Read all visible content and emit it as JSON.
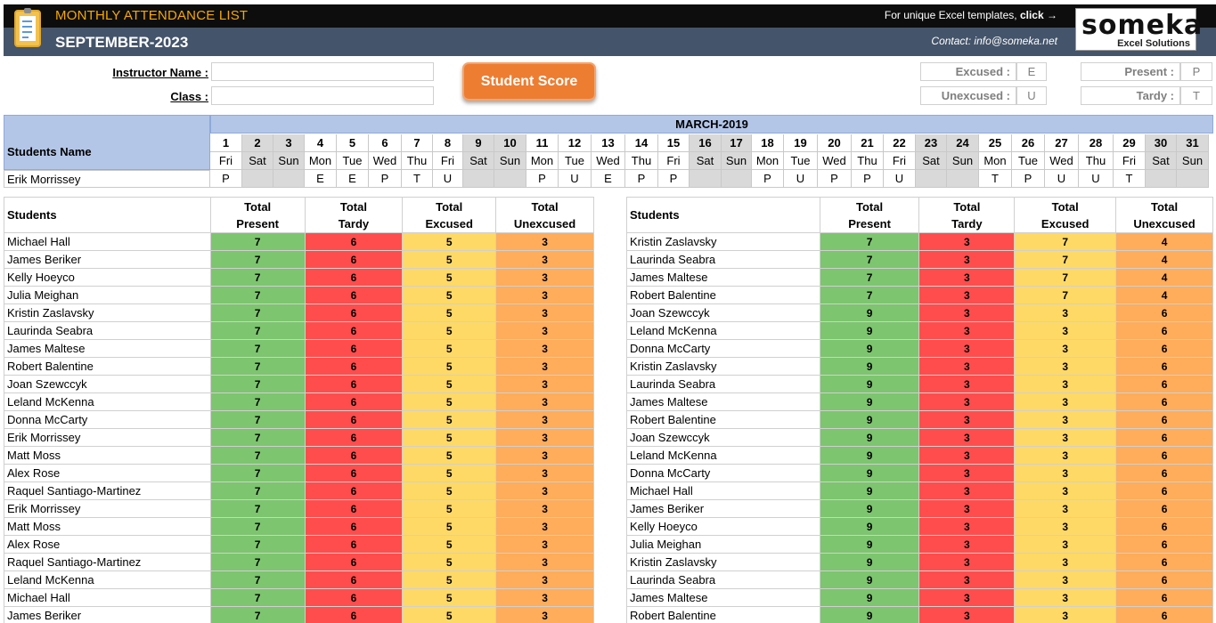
{
  "header": {
    "title": "MONTHLY ATTENDANCE LIST",
    "month": "SEPTEMBER-2023",
    "promo_text": "For unique Excel templates,",
    "promo_link": "click →",
    "contact": "Contact: info@someka.net",
    "brand": "someka",
    "brand_sub": "Excel Solutions"
  },
  "form": {
    "instructor_label": "Instructor Name :",
    "instructor_value": "",
    "class_label": "Class :",
    "class_value": ""
  },
  "score_button": "Student Score",
  "legend": {
    "excused_label": "Excused :",
    "excused_code": "E",
    "unexcused_label": "Unexcused :",
    "unexcused_code": "U",
    "present_label": "Present :",
    "present_code": "P",
    "tardy_label": "Tardy :",
    "tardy_code": "T"
  },
  "calendar": {
    "month_title": "MARCH-2019",
    "names_header": "Students Name",
    "days": [
      "1",
      "2",
      "3",
      "4",
      "5",
      "6",
      "7",
      "8",
      "9",
      "10",
      "11",
      "12",
      "13",
      "14",
      "15",
      "16",
      "17",
      "18",
      "19",
      "20",
      "21",
      "22",
      "23",
      "24",
      "25",
      "26",
      "27",
      "28",
      "29",
      "30",
      "31"
    ],
    "weekdays": [
      "Fri",
      "Sat",
      "Sun",
      "Mon",
      "Tue",
      "Wed",
      "Thu",
      "Fri",
      "Sat",
      "Sun",
      "Mon",
      "Tue",
      "Wed",
      "Thu",
      "Fri",
      "Sat",
      "Sun",
      "Mon",
      "Tue",
      "Wed",
      "Thu",
      "Fri",
      "Sat",
      "Sun",
      "Mon",
      "Tue",
      "Wed",
      "Thu",
      "Fri",
      "Sat",
      "Sun"
    ],
    "weekend": [
      false,
      true,
      true,
      false,
      false,
      false,
      false,
      false,
      true,
      true,
      false,
      false,
      false,
      false,
      false,
      true,
      true,
      false,
      false,
      false,
      false,
      false,
      true,
      true,
      false,
      false,
      false,
      false,
      false,
      true,
      true
    ],
    "student": "Erik Morrissey",
    "marks": [
      "P",
      "",
      "",
      "E",
      "E",
      "P",
      "T",
      "U",
      "",
      "",
      "P",
      "U",
      "E",
      "P",
      "P",
      "",
      "",
      "P",
      "U",
      "P",
      "P",
      "U",
      "",
      "",
      "T",
      "P",
      "U",
      "U",
      "T",
      "",
      ""
    ]
  },
  "summary": {
    "headers": {
      "students": "Students",
      "present": [
        "Total",
        "Present"
      ],
      "tardy": [
        "Total",
        "Tardy"
      ],
      "excused": [
        "Total",
        "Excused"
      ],
      "unexcused": [
        "Total",
        "Unexcused"
      ]
    },
    "left": [
      {
        "name": "Michael Hall",
        "present": "7",
        "tardy": "6",
        "excused": "5",
        "unexcused": "3"
      },
      {
        "name": "James Beriker",
        "present": "7",
        "tardy": "6",
        "excused": "5",
        "unexcused": "3"
      },
      {
        "name": "Kelly Hoeyco",
        "present": "7",
        "tardy": "6",
        "excused": "5",
        "unexcused": "3"
      },
      {
        "name": "Julia Meighan",
        "present": "7",
        "tardy": "6",
        "excused": "5",
        "unexcused": "3"
      },
      {
        "name": "Kristin Zaslavsky",
        "present": "7",
        "tardy": "6",
        "excused": "5",
        "unexcused": "3"
      },
      {
        "name": "Laurinda Seabra",
        "present": "7",
        "tardy": "6",
        "excused": "5",
        "unexcused": "3"
      },
      {
        "name": "James Maltese",
        "present": "7",
        "tardy": "6",
        "excused": "5",
        "unexcused": "3"
      },
      {
        "name": "Robert Balentine",
        "present": "7",
        "tardy": "6",
        "excused": "5",
        "unexcused": "3"
      },
      {
        "name": "Joan Szewccyk",
        "present": "7",
        "tardy": "6",
        "excused": "5",
        "unexcused": "3"
      },
      {
        "name": "Leland McKenna",
        "present": "7",
        "tardy": "6",
        "excused": "5",
        "unexcused": "3"
      },
      {
        "name": "Donna McCarty",
        "present": "7",
        "tardy": "6",
        "excused": "5",
        "unexcused": "3"
      },
      {
        "name": "Erik Morrissey",
        "present": "7",
        "tardy": "6",
        "excused": "5",
        "unexcused": "3"
      },
      {
        "name": "Matt Moss",
        "present": "7",
        "tardy": "6",
        "excused": "5",
        "unexcused": "3"
      },
      {
        "name": "Alex Rose",
        "present": "7",
        "tardy": "6",
        "excused": "5",
        "unexcused": "3"
      },
      {
        "name": "Raquel Santiago-Martinez",
        "present": "7",
        "tardy": "6",
        "excused": "5",
        "unexcused": "3"
      },
      {
        "name": "Erik Morrissey",
        "present": "7",
        "tardy": "6",
        "excused": "5",
        "unexcused": "3"
      },
      {
        "name": "Matt Moss",
        "present": "7",
        "tardy": "6",
        "excused": "5",
        "unexcused": "3"
      },
      {
        "name": "Alex Rose",
        "present": "7",
        "tardy": "6",
        "excused": "5",
        "unexcused": "3"
      },
      {
        "name": "Raquel Santiago-Martinez",
        "present": "7",
        "tardy": "6",
        "excused": "5",
        "unexcused": "3"
      },
      {
        "name": "Leland McKenna",
        "present": "7",
        "tardy": "6",
        "excused": "5",
        "unexcused": "3"
      },
      {
        "name": "Michael Hall",
        "present": "7",
        "tardy": "6",
        "excused": "5",
        "unexcused": "3"
      },
      {
        "name": "James Beriker",
        "present": "7",
        "tardy": "6",
        "excused": "5",
        "unexcused": "3"
      }
    ],
    "right": [
      {
        "name": "Kristin Zaslavsky",
        "present": "7",
        "tardy": "3",
        "excused": "7",
        "unexcused": "4"
      },
      {
        "name": "Laurinda Seabra",
        "present": "7",
        "tardy": "3",
        "excused": "7",
        "unexcused": "4"
      },
      {
        "name": "James Maltese",
        "present": "7",
        "tardy": "3",
        "excused": "7",
        "unexcused": "4"
      },
      {
        "name": "Robert Balentine",
        "present": "7",
        "tardy": "3",
        "excused": "7",
        "unexcused": "4"
      },
      {
        "name": "Joan Szewccyk",
        "present": "9",
        "tardy": "3",
        "excused": "3",
        "unexcused": "6"
      },
      {
        "name": "Leland McKenna",
        "present": "9",
        "tardy": "3",
        "excused": "3",
        "unexcused": "6"
      },
      {
        "name": "Donna McCarty",
        "present": "9",
        "tardy": "3",
        "excused": "3",
        "unexcused": "6"
      },
      {
        "name": "Kristin Zaslavsky",
        "present": "9",
        "tardy": "3",
        "excused": "3",
        "unexcused": "6"
      },
      {
        "name": "Laurinda Seabra",
        "present": "9",
        "tardy": "3",
        "excused": "3",
        "unexcused": "6"
      },
      {
        "name": "James Maltese",
        "present": "9",
        "tardy": "3",
        "excused": "3",
        "unexcused": "6"
      },
      {
        "name": "Robert Balentine",
        "present": "9",
        "tardy": "3",
        "excused": "3",
        "unexcused": "6"
      },
      {
        "name": "Joan Szewccyk",
        "present": "9",
        "tardy": "3",
        "excused": "3",
        "unexcused": "6"
      },
      {
        "name": "Leland McKenna",
        "present": "9",
        "tardy": "3",
        "excused": "3",
        "unexcused": "6"
      },
      {
        "name": "Donna McCarty",
        "present": "9",
        "tardy": "3",
        "excused": "3",
        "unexcused": "6"
      },
      {
        "name": "Michael Hall",
        "present": "9",
        "tardy": "3",
        "excused": "3",
        "unexcused": "6"
      },
      {
        "name": "James Beriker",
        "present": "9",
        "tardy": "3",
        "excused": "3",
        "unexcused": "6"
      },
      {
        "name": "Kelly Hoeyco",
        "present": "9",
        "tardy": "3",
        "excused": "3",
        "unexcused": "6"
      },
      {
        "name": "Julia Meighan",
        "present": "9",
        "tardy": "3",
        "excused": "3",
        "unexcused": "6"
      },
      {
        "name": "Kristin Zaslavsky",
        "present": "9",
        "tardy": "3",
        "excused": "3",
        "unexcused": "6"
      },
      {
        "name": "Laurinda Seabra",
        "present": "9",
        "tardy": "3",
        "excused": "3",
        "unexcused": "6"
      },
      {
        "name": "James Maltese",
        "present": "9",
        "tardy": "3",
        "excused": "3",
        "unexcused": "6"
      },
      {
        "name": "Robert Balentine",
        "present": "9",
        "tardy": "3",
        "excused": "3",
        "unexcused": "6"
      }
    ]
  },
  "colors": {
    "present": "#7dc56f",
    "tardy": "#ff4d4d",
    "excused": "#ffd966",
    "unexcused": "#ffac5b",
    "header_bar": "#44546a",
    "accent": "#ed7d31"
  }
}
